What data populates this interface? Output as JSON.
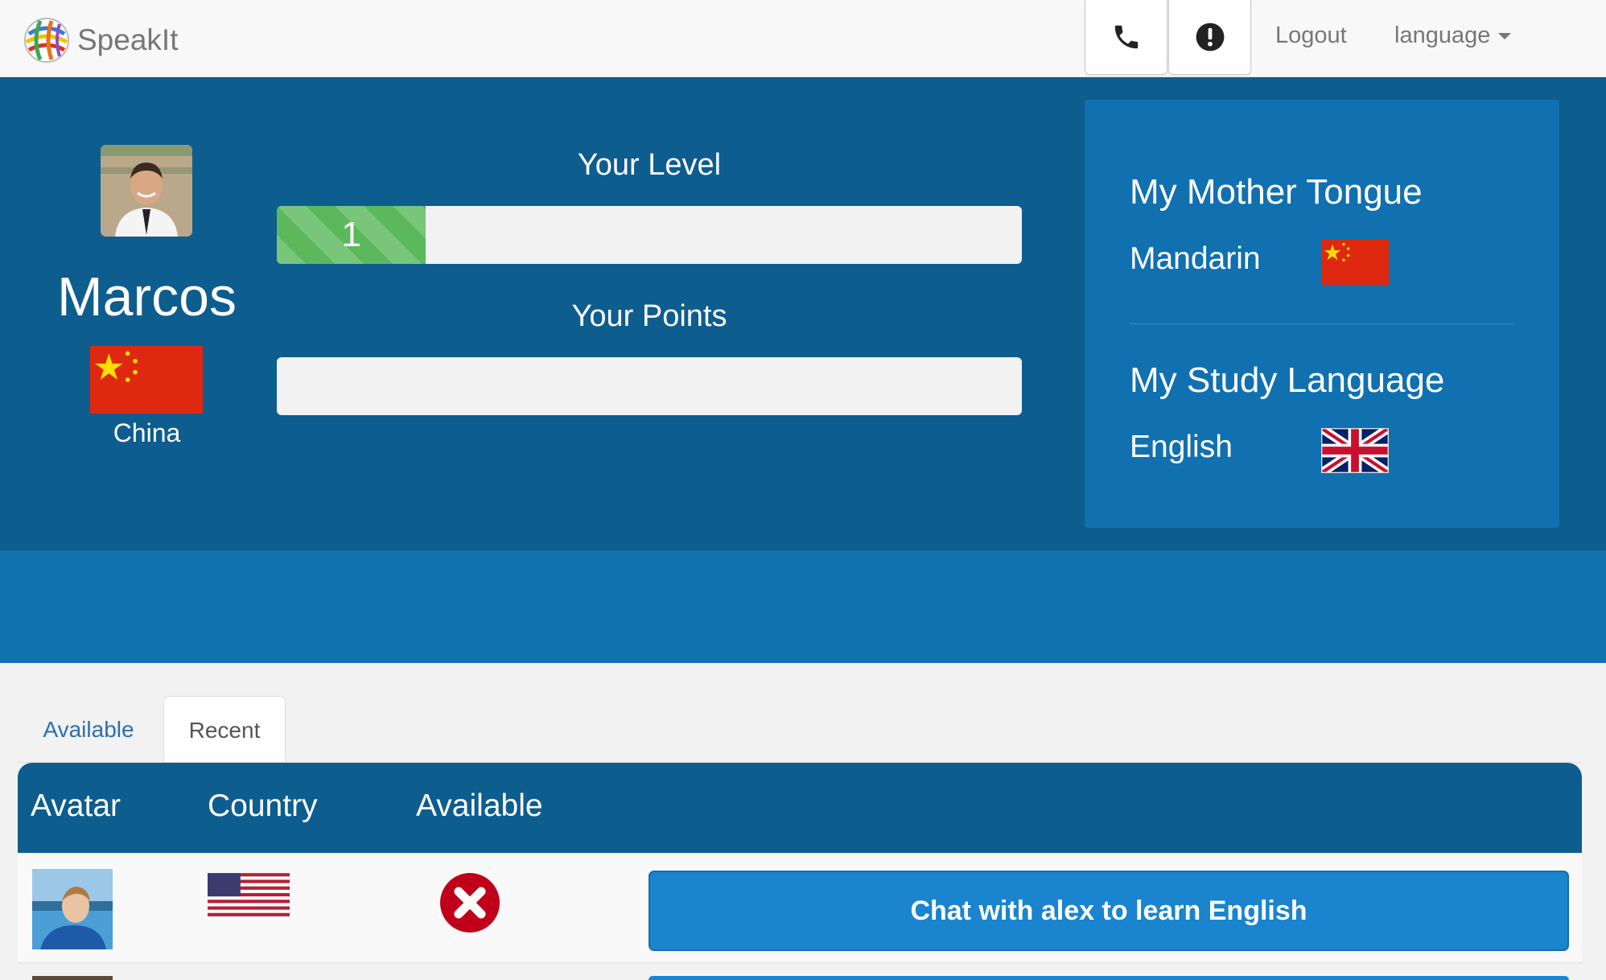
{
  "app": {
    "brand": "SpeakIt"
  },
  "navbar": {
    "call_icon": "phone-icon",
    "alert_icon": "exclamation-circle-icon",
    "logout_label": "Logout",
    "language_label": "language"
  },
  "profile": {
    "name": "Marcos",
    "country": "China",
    "country_flag": "china-flag"
  },
  "level": {
    "title": "Your Level",
    "value": "1",
    "progress_fraction": 0.2
  },
  "points": {
    "title": "Your Points",
    "progress_fraction": 0.0
  },
  "languages": {
    "mother_tongue_heading": "My Mother Tongue",
    "mother_tongue": "Mandarin",
    "mother_tongue_flag": "china-flag",
    "study_heading": "My Study Language",
    "study_language": "English",
    "study_flag": "uk-flag"
  },
  "tabs": [
    {
      "label": "Available",
      "active": false
    },
    {
      "label": "Recent",
      "active": true
    }
  ],
  "table": {
    "columns": [
      "Avatar",
      "Country",
      "Available"
    ],
    "rows": [
      {
        "country_flag": "us-flag",
        "available_icon": "unavailable-x-icon",
        "button_label": "Chat with alex to learn English"
      }
    ]
  },
  "colors": {
    "hero": "#0e5d8f",
    "hero_band": "#1172b0",
    "panel": "#1170b0",
    "progress": "#5cb85c",
    "chat_button": "#1a84ce",
    "status_unavailable": "#c0001a"
  }
}
